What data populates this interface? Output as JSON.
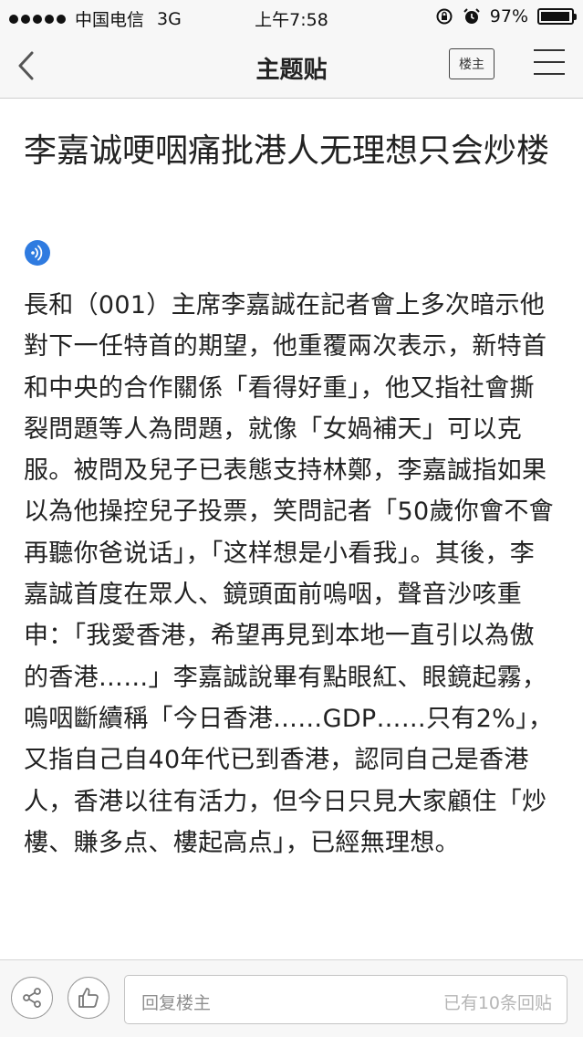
{
  "status_bar": {
    "carrier": "中国电信",
    "network": "3G",
    "time": "上午7:58",
    "battery": "97%",
    "battery_level": 0.97
  },
  "nav": {
    "title": "主题贴",
    "op_button_label": "楼主"
  },
  "post": {
    "title": "李嘉诚哽咽痛批港人无理想只会炒楼",
    "body": "長和（001）主席李嘉誠在記者會上多次暗示他對下一任特首的期望，他重覆兩次表示，新特首和中央的合作關係「看得好重」，他又指社會撕裂問題等人為問題，就像「女媧補天」可以克服。被問及兒子已表態支持林鄭，李嘉誠指如果以為他操控兒子投票，笑問記者「50歲你會不會再聽你爸说话」，「这样想是小看我」。其後，李嘉誠首度在眾人、鏡頭面前嗚咽，聲音沙咳重申：「我愛香港，希望再見到本地一直引以為傲的香港……」李嘉誠說畢有點眼紅、眼鏡起霧，嗚咽斷續稱「今日香港……GDP……只有2%」，又指自己自40年代已到香港，認同自己是香港人，香港以往有活力，但今日只見大家顧住「炒樓、賺多点、樓起高点」，已經無理想。"
  },
  "bottom_bar": {
    "reply_placeholder": "回复楼主",
    "reply_count": "已有10条回贴"
  },
  "colors": {
    "accent_blue": "#2f7be0",
    "bar_background": "#f7f7f7"
  },
  "icons": [
    "back-chevron-icon",
    "menu-icon",
    "audio-icon",
    "share-icon",
    "thumbs-up-icon",
    "alarm-icon",
    "rotation-lock-icon"
  ]
}
